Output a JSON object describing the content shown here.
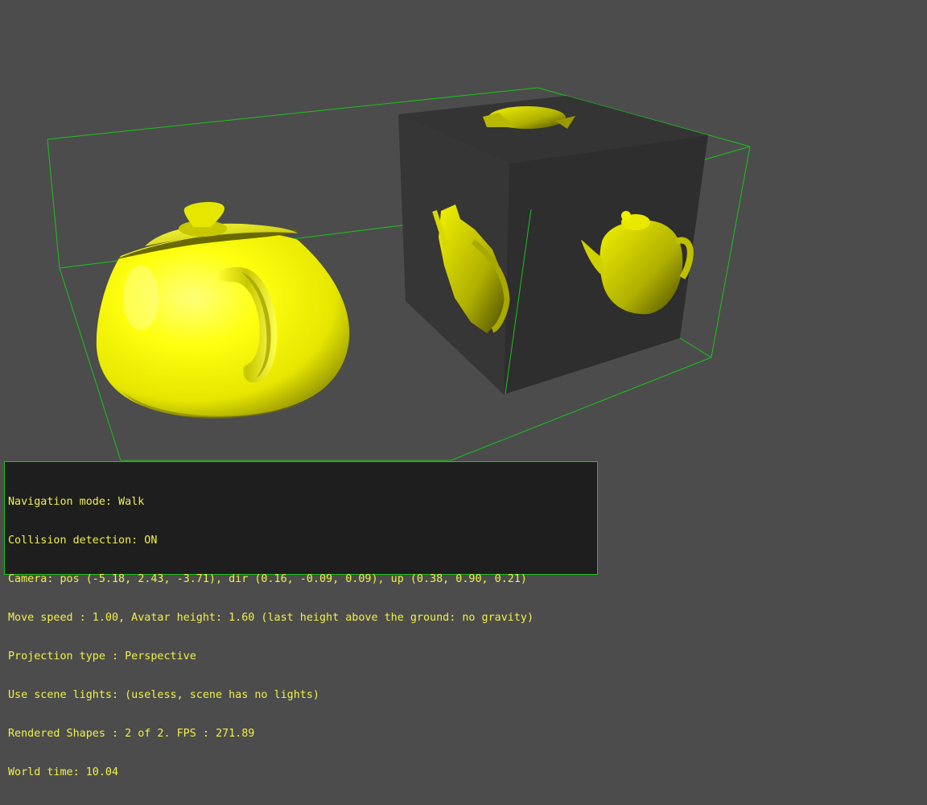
{
  "viewport": {
    "background": "#4c4c4c",
    "bounding_box_color": "#19c419",
    "teapot_color": "#ffff00",
    "cube_color": "#383838"
  },
  "hud": {
    "navigation_mode": "Navigation mode: Walk",
    "collision_detection": "Collision detection: ON",
    "camera": "Camera: pos (-5.18, 2.43, -3.71), dir (0.16, -0.09, 0.09), up (0.38, 0.90, 0.21)",
    "move_speed": "Move speed : 1.00, Avatar height: 1.60 (last height above the ground: no gravity)",
    "projection_type": "Projection type : Perspective",
    "scene_lights": "Use scene lights: (useless, scene has no lights)",
    "rendered_shapes": "Rendered Shapes : 2 of 2. FPS : 271.89",
    "world_time": "World time: 10.04"
  }
}
